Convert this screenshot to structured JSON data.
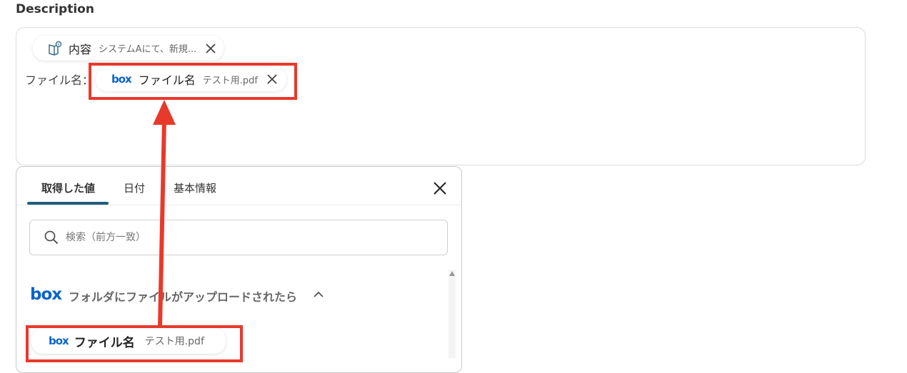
{
  "description_label": "Description",
  "editor": {
    "content_chip": {
      "icon": "book-info-icon",
      "title": "内容",
      "value": "システムAにて、新規..."
    },
    "static_text": "ファイル名：",
    "file_chip": {
      "logo": "box",
      "title": "ファイル名",
      "value": "テスト用.pdf"
    }
  },
  "panel": {
    "tabs": [
      {
        "label": "取得した値",
        "active": true
      },
      {
        "label": "日付",
        "active": false
      },
      {
        "label": "基本情報",
        "active": false
      }
    ],
    "search": {
      "placeholder": "検索（前方一致）",
      "value": ""
    },
    "section": {
      "logo": "box",
      "title": "フォルダにファイルがアップロードされたら",
      "expanded": true
    },
    "result_chip": {
      "logo": "box",
      "title": "ファイル名",
      "value": "テスト用.pdf"
    }
  },
  "colors": {
    "highlight": "#e8392b",
    "box_blue": "#0a64c8",
    "tab_underline": "#1f5f7a"
  }
}
